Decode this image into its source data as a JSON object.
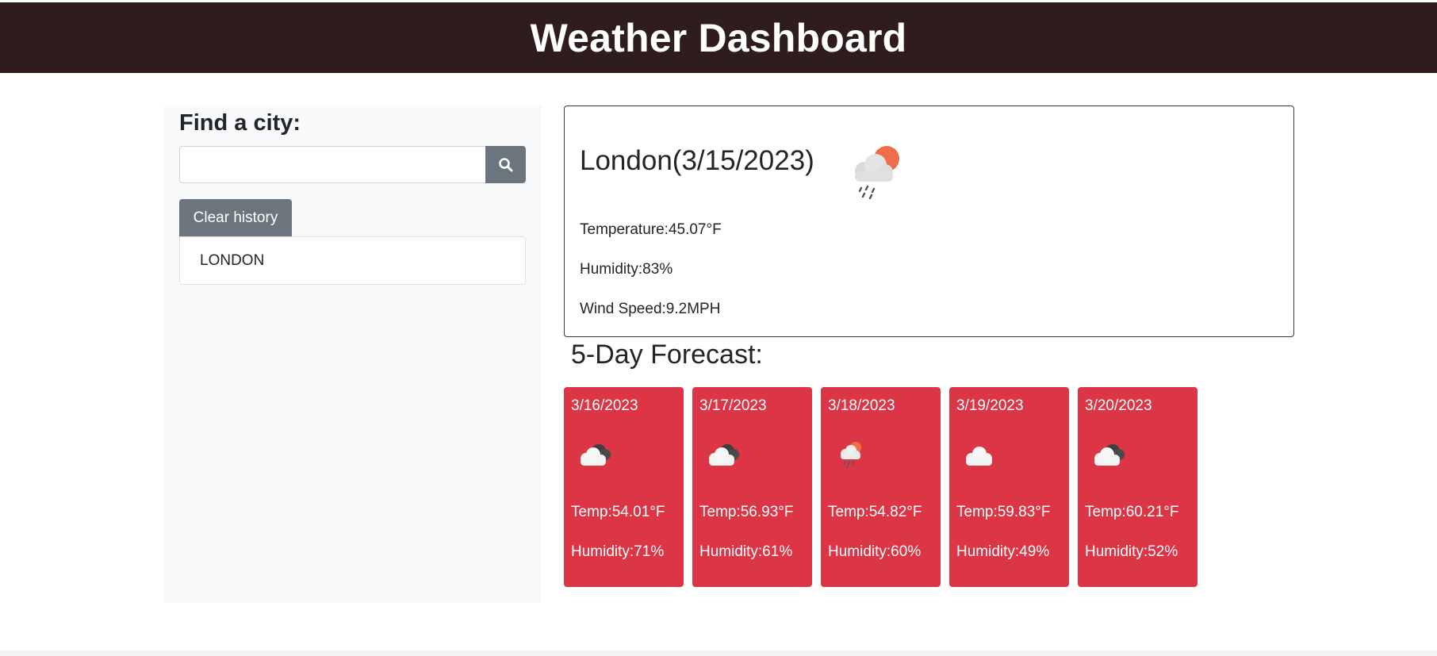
{
  "header": {
    "title": "Weather Dashboard"
  },
  "sidebar": {
    "find_label": "Find a city:",
    "search": {
      "placeholder": "",
      "value": ""
    },
    "search_icon": "search-icon",
    "clear_label": "Clear history",
    "history": [
      "LONDON"
    ]
  },
  "current": {
    "title": "London(3/15/2023)",
    "icon": "rain-sun-icon",
    "temperature": "Temperature:45.07°F",
    "humidity": "Humidity:83%",
    "wind": "Wind Speed:9.2MPH"
  },
  "forecast": {
    "title": "5-Day Forecast:",
    "days": [
      {
        "date": "3/16/2023",
        "icon": "overcast-clouds-icon",
        "temp": "Temp:54.01°F",
        "humidity": "Humidity:71%"
      },
      {
        "date": "3/17/2023",
        "icon": "overcast-clouds-icon",
        "temp": "Temp:56.93°F",
        "humidity": "Humidity:61%"
      },
      {
        "date": "3/18/2023",
        "icon": "rain-sun-icon",
        "temp": "Temp:54.82°F",
        "humidity": "Humidity:60%"
      },
      {
        "date": "3/19/2023",
        "icon": "cloud-icon",
        "temp": "Temp:59.83°F",
        "humidity": "Humidity:49%"
      },
      {
        "date": "3/20/2023",
        "icon": "overcast-clouds-icon",
        "temp": "Temp:60.21°F",
        "humidity": "Humidity:52%"
      }
    ]
  },
  "colors": {
    "header_bg": "#2f1c1c",
    "card_bg": "#dc3545",
    "button_bg": "#6c757d",
    "sidebar_bg": "#f8f9fa"
  }
}
